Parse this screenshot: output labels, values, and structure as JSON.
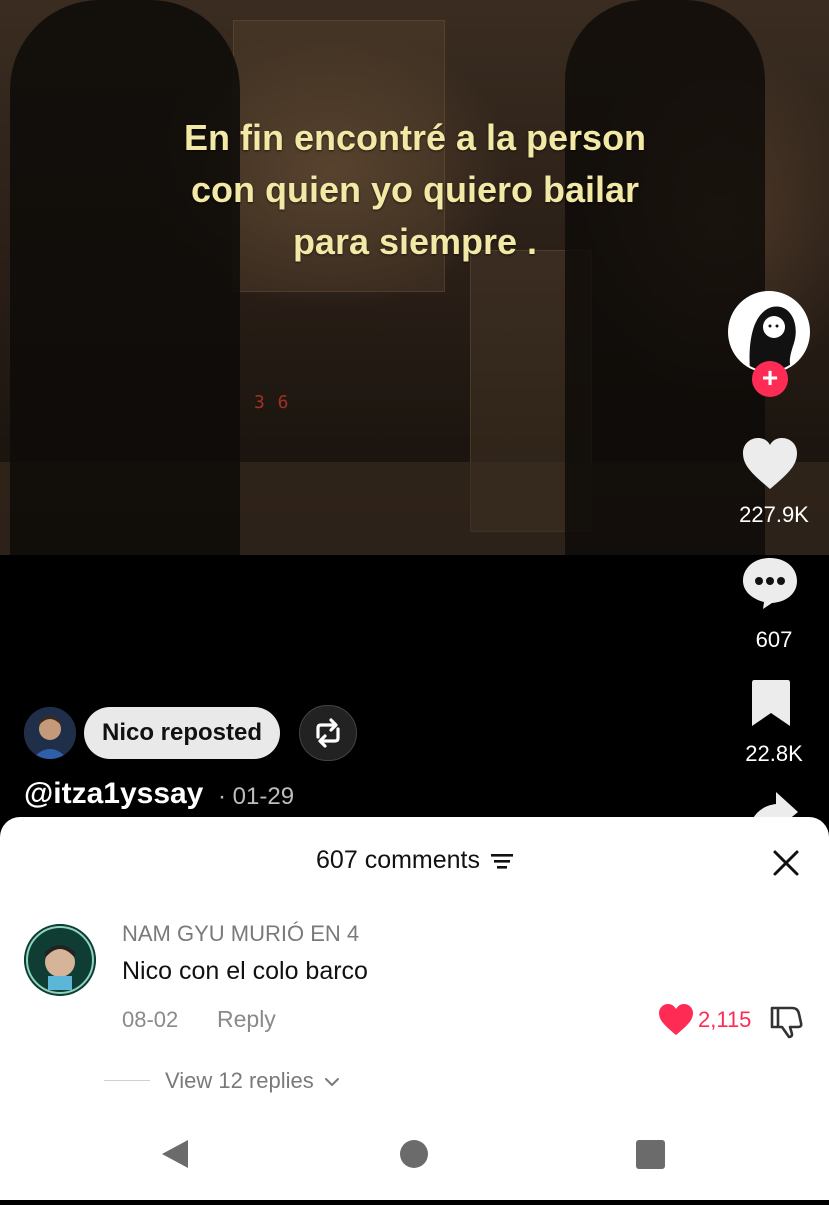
{
  "video": {
    "caption_lines": [
      "En fin encontré a la person",
      "con quien yo quiero bailar",
      "para siempre ."
    ]
  },
  "rail": {
    "likes": "227.9K",
    "comments": "607",
    "saves": "22.8K",
    "follow_symbol": "+"
  },
  "post": {
    "repost_label": "Nico reposted",
    "handle": "@itza1yssay",
    "date": "· 01-29"
  },
  "comments_sheet": {
    "title": "607 comments",
    "comment": {
      "username": "NAM GYU MURIÓ EN 4",
      "text": "Nico con el colo barco",
      "date": "08-02",
      "reply_label": "Reply",
      "likes": "2,115",
      "view_replies": "View 12 replies"
    }
  },
  "colors": {
    "accent": "#fe2c55",
    "caption": "#f2e9a6"
  },
  "icons": [
    "heart-icon",
    "comment-icon",
    "bookmark-icon",
    "share-icon",
    "repost-icon",
    "filter-icon",
    "close-icon",
    "like-icon",
    "dislike-icon",
    "chevron-down-icon",
    "back-icon",
    "home-icon",
    "recents-icon"
  ]
}
